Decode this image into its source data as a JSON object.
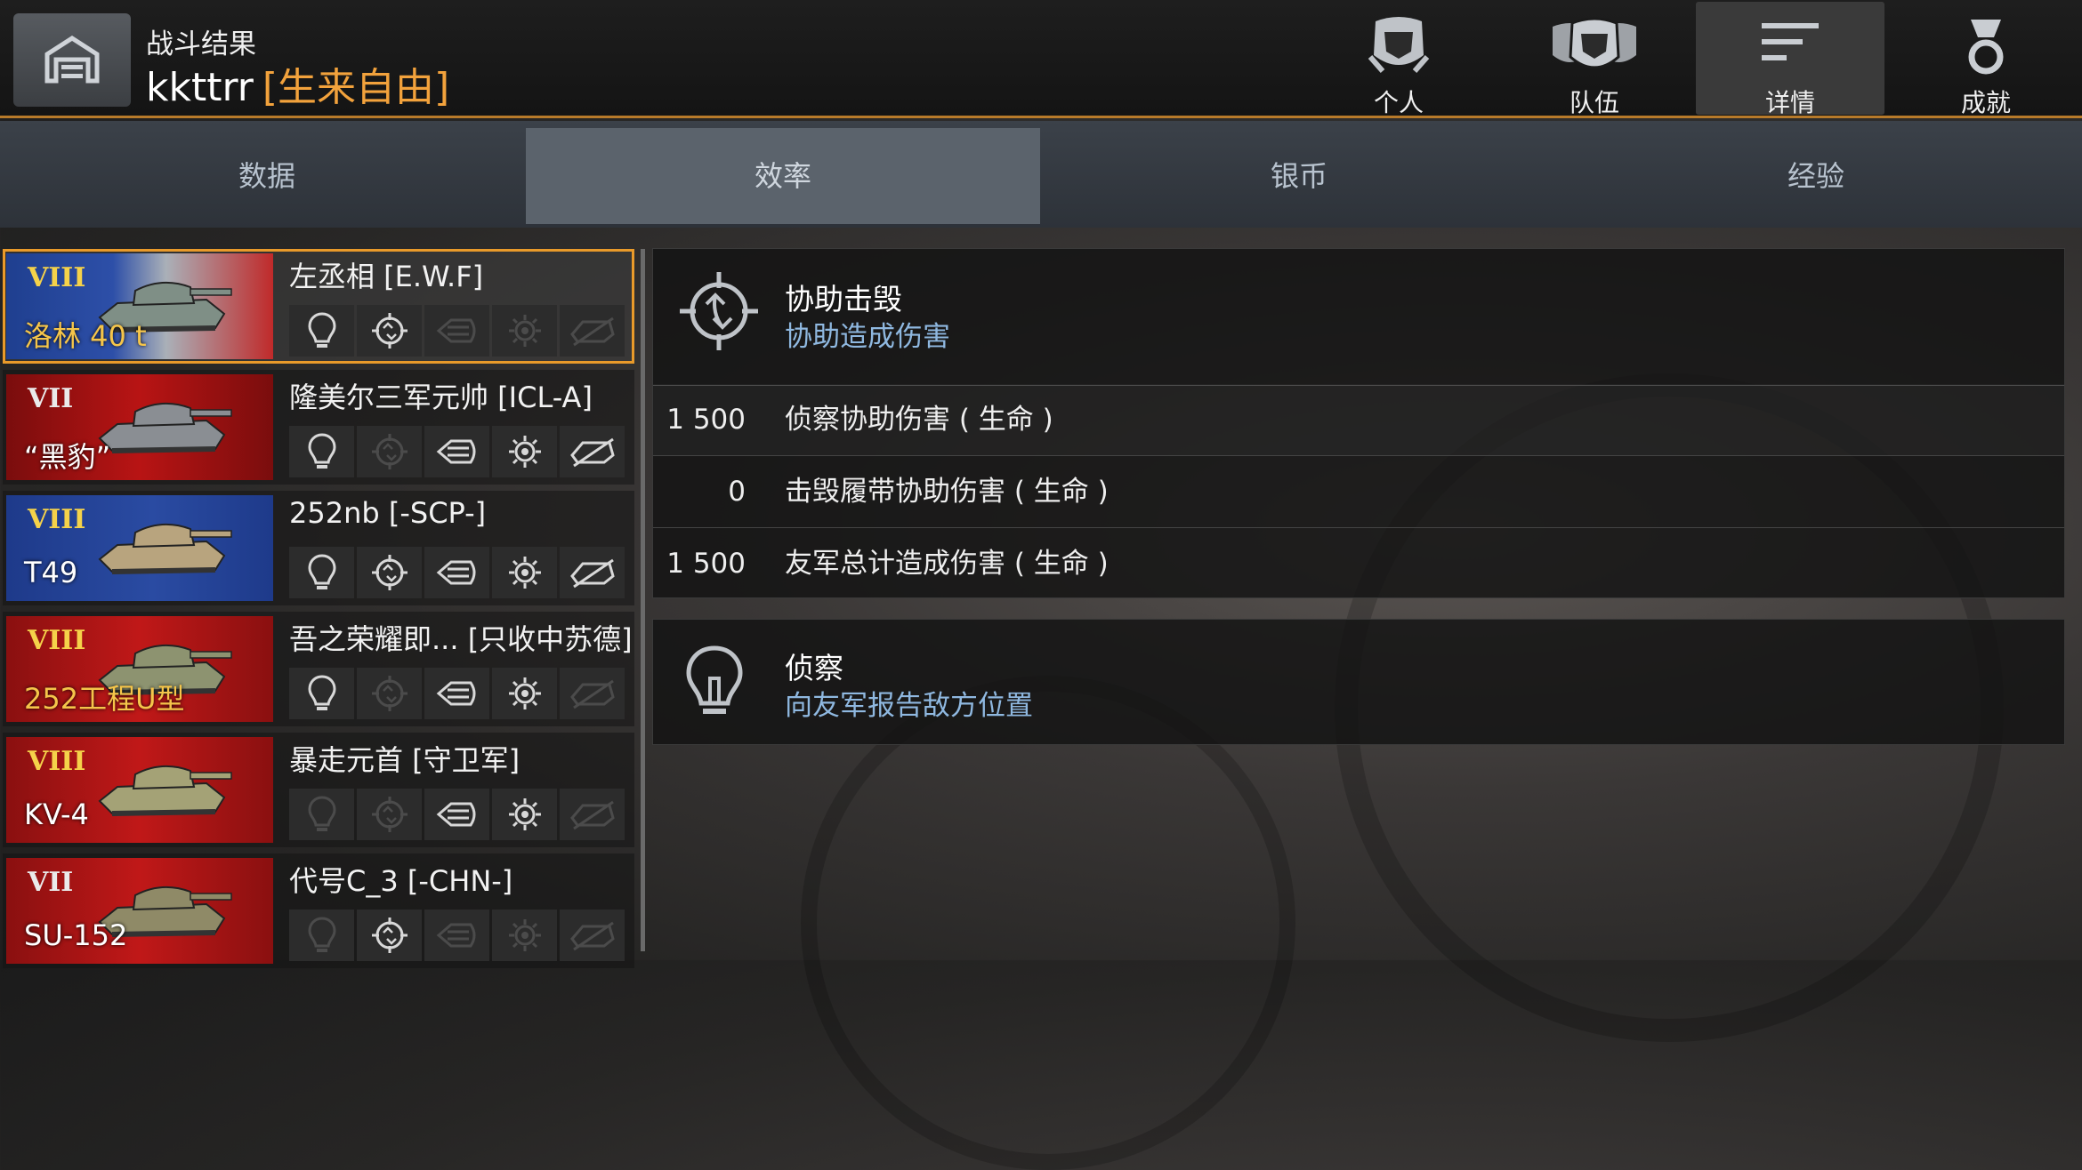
{
  "header": {
    "section_label": "战斗结果",
    "player_name": "kkttrr",
    "player_clan": "[生来自由]",
    "nav": [
      {
        "label": "个人",
        "icon": "personal-helmet-icon"
      },
      {
        "label": "队伍",
        "icon": "team-helmets-icon"
      },
      {
        "label": "详情",
        "icon": "details-lines-icon"
      },
      {
        "label": "成就",
        "icon": "medal-icon"
      }
    ],
    "active_nav": "详情"
  },
  "tabs": [
    "数据",
    "效率",
    "银币",
    "经验"
  ],
  "active_tab": "效率",
  "players": [
    {
      "tank": "洛林 40 t",
      "tier": "VIII",
      "player": "左丞相 [E.W.F]",
      "nation": "france",
      "selected": true,
      "icons": {
        "spotting": true,
        "assist": true,
        "track": false,
        "damage": false,
        "block": false
      }
    },
    {
      "tank": "“黑豹”",
      "tier": "VII",
      "player": "隆美尔三军元帅 [ICL-A]",
      "nation": "germany",
      "selected": false,
      "icons": {
        "spotting": true,
        "assist": false,
        "track": true,
        "damage": true,
        "block": true
      }
    },
    {
      "tank": "T49",
      "tier": "VIII",
      "player": "252nb [-SCP-]",
      "nation": "usa",
      "selected": false,
      "icons": {
        "spotting": true,
        "assist": true,
        "track": true,
        "damage": true,
        "block": true
      }
    },
    {
      "tank": "252工程U型",
      "tier": "VIII",
      "player": "吾之荣耀即... [只收中苏德]",
      "nation": "ussr",
      "selected": false,
      "icons": {
        "spotting": true,
        "assist": false,
        "track": true,
        "damage": true,
        "block": false
      }
    },
    {
      "tank": "KV-4",
      "tier": "VIII",
      "player": "暴走元首 [守卫军]",
      "nation": "ussr",
      "selected": false,
      "icons": {
        "spotting": false,
        "assist": false,
        "track": true,
        "damage": true,
        "block": false
      }
    },
    {
      "tank": "SU-152",
      "tier": "VII",
      "player": "代号C_3 [-CHN-]",
      "nation": "ussr",
      "selected": false,
      "icons": {
        "spotting": false,
        "assist": true,
        "track": false,
        "damage": false,
        "block": false
      }
    }
  ],
  "assist_panel": {
    "title": "协助击毁",
    "subtitle": "协助造成伤害",
    "rows": [
      {
        "value": "1 500",
        "label": "侦察协助伤害 ( 生命 )"
      },
      {
        "value": "0",
        "label": "击毁履带协助伤害 ( 生命 )"
      },
      {
        "value": "1 500",
        "label": "友军总计造成伤害 ( 生命 )"
      }
    ]
  },
  "spotting_panel": {
    "title": "侦察",
    "subtitle": "向友军报告敌方位置"
  },
  "colors": {
    "accent": "#e99a2a",
    "clan": "#f2a23c",
    "subtitle": "#8fb8e0",
    "tier_gold": "#f5d24a"
  }
}
